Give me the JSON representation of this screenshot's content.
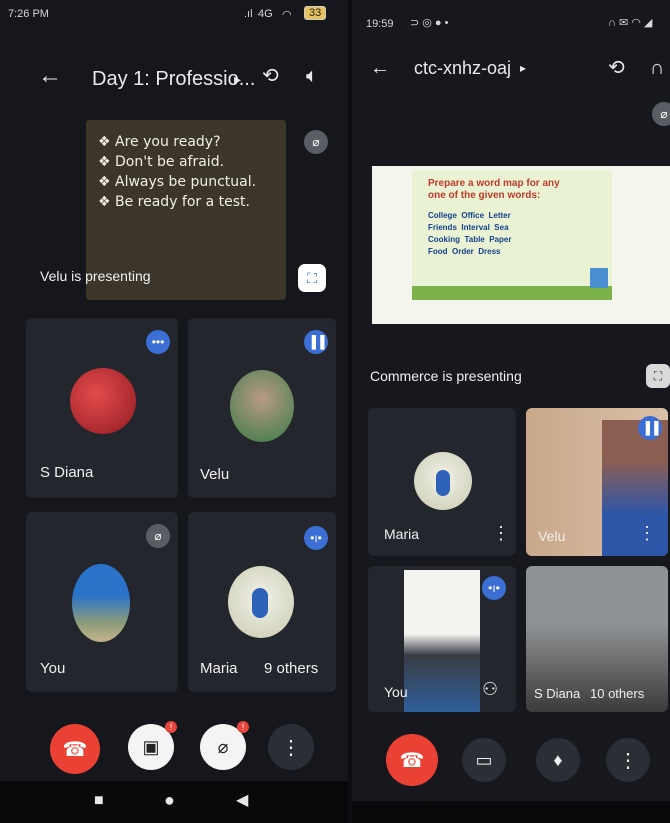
{
  "left": {
    "status": {
      "time": "7:26 PM",
      "signal": "4G",
      "battery": "33"
    },
    "header": {
      "title": "Day 1: Professio...",
      "dropdown": "▸"
    },
    "presentation": {
      "lines": [
        "❖ Are you ready?",
        "❖ Don't be afraid.",
        "❖ Always be punctual.",
        "❖ Be ready for a test."
      ],
      "caption": "Velu is presenting"
    },
    "tiles": [
      {
        "name": "S Diana"
      },
      {
        "name": "Velu"
      },
      {
        "name": "You"
      },
      {
        "name": "Maria",
        "others": "9 others"
      }
    ],
    "controls": {
      "end_call": "end-call",
      "camera": "camera-off",
      "mic": "mic-off",
      "more": "more"
    },
    "badge_count": "!"
  },
  "right": {
    "status": {
      "time": "19:59"
    },
    "header": {
      "title": "ctc-xnhz-oaj",
      "dropdown": "▸"
    },
    "slide": {
      "heading": "Prepare a word map for any one of the given words:",
      "words": [
        [
          "College",
          "Office",
          "Letter"
        ],
        [
          "Friends",
          "Interval",
          "Sea"
        ],
        [
          "Cooking",
          "Table",
          "Paper"
        ],
        [
          "Food",
          "Order",
          "Dress"
        ]
      ]
    },
    "caption": "Commerce is presenting",
    "tiles": [
      {
        "name": "Maria"
      },
      {
        "name": "Velu"
      },
      {
        "name": "You"
      },
      {
        "name": "S Diana",
        "others": "10 others"
      }
    ]
  },
  "colors": {
    "end_call": "#e94235",
    "badge": "#3b6fd4",
    "tile": "#23262c"
  }
}
